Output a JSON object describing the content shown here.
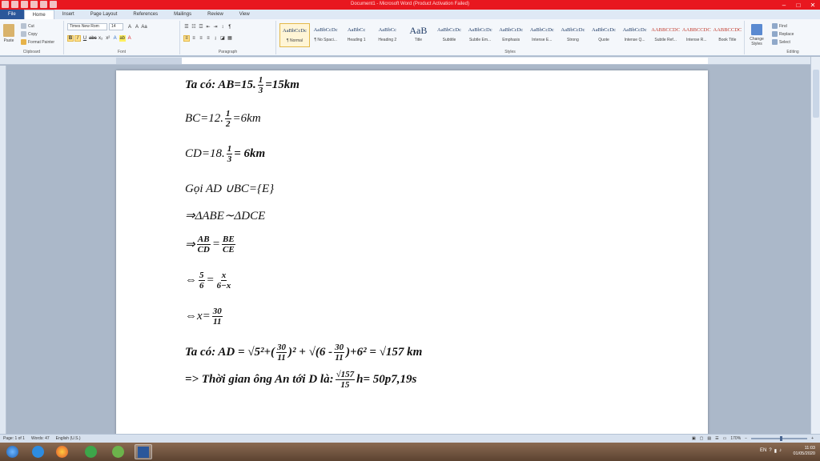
{
  "window": {
    "title": "Document1 - Microsoft Word (Product Activation Failed)",
    "minimize": "–",
    "maximize": "□",
    "close": "✕"
  },
  "tabs": [
    "File",
    "Home",
    "Insert",
    "Page Layout",
    "References",
    "Mailings",
    "Review",
    "View"
  ],
  "ribbon": {
    "clipboard": {
      "label": "Clipboard",
      "paste": "Paste",
      "cut": "Cut",
      "copy": "Copy",
      "format_painter": "Format Painter"
    },
    "font": {
      "label": "Font",
      "font_name": "Times New Rom",
      "font_size": "14",
      "grow": "A",
      "shrink": "A",
      "clear": "Aa",
      "bold": "B",
      "italic": "I",
      "underline": "U",
      "strike": "abc",
      "subscript": "x₂",
      "superscript": "x²",
      "text_effects": "A",
      "highlight": "ab",
      "font_color": "A"
    },
    "paragraph": {
      "label": "Paragraph"
    },
    "styles": {
      "label": "Styles",
      "items": [
        {
          "sample": "AaBbCcDc",
          "name": "¶ Normal"
        },
        {
          "sample": "AaBbCcDc",
          "name": "¶ No Spaci..."
        },
        {
          "sample": "AaBbCc",
          "name": "Heading 1"
        },
        {
          "sample": "AaBbCc",
          "name": "Heading 2"
        },
        {
          "sample": "AaB",
          "name": "Title"
        },
        {
          "sample": "AaBbCcDc",
          "name": "Subtitle"
        },
        {
          "sample": "AaBbCcDc",
          "name": "Subtle Em..."
        },
        {
          "sample": "AaBbCcDc",
          "name": "Emphasis"
        },
        {
          "sample": "AaBbCcDc",
          "name": "Intense E..."
        },
        {
          "sample": "AaBbCcDc",
          "name": "Strong"
        },
        {
          "sample": "AaBbCcDc",
          "name": "Quote"
        },
        {
          "sample": "AaBbCcDc",
          "name": "Intense Q..."
        },
        {
          "sample": "AABBCCDC",
          "name": "Subtle Ref..."
        },
        {
          "sample": "AABBCCDC",
          "name": "Intense R..."
        },
        {
          "sample": "AABBCCDC",
          "name": "Book Title"
        }
      ],
      "change_styles": "Change Styles"
    },
    "editing": {
      "label": "Editing",
      "find": "Find",
      "replace": "Replace",
      "select": "Select"
    }
  },
  "document": {
    "l1_prefix": "Ta có: AB=15.",
    "l1_num": "1",
    "l1_den": "3",
    "l1_suffix": "=15km",
    "l2_prefix": "BC=12.",
    "l2_num": "1",
    "l2_den": "2",
    "l2_suffix": "=6km",
    "l3_prefix": "CD=18.",
    "l3_num": "1",
    "l3_den": "3",
    "l3_suffix": "= 6km",
    "l4": "Gọi AD ∪BC={E}",
    "l5": "⇒ΔABE∼ΔDCE",
    "l6_prefix": "⇒",
    "l6_n1": "AB",
    "l6_d1": "CD",
    "l6_eq": "=",
    "l6_n2": "BE",
    "l6_d2": "CE",
    "l7_prefix": "⇔",
    "l7_n1": "5",
    "l7_d1": "6",
    "l7_eq": "=",
    "l7_n2": "x",
    "l7_d2": "6−x",
    "l8_prefix": "⇔x=",
    "l8_num": "30",
    "l8_den": "11",
    "l9_a": "Ta có: AD = √5²+(",
    "l9_n1": "30",
    "l9_d1": "11",
    "l9_b": ")² + √(6 -",
    "l9_n2": "30",
    "l9_d2": "11",
    "l9_c": ")+6² = √157 km",
    "l10_a": "=> Thời gian ông An tới D là:",
    "l10_num": "√157",
    "l10_den": "15",
    "l10_b": "h= 50p7,19s"
  },
  "status": {
    "page": "Page: 1 of 1",
    "words": "Words: 47",
    "language": "English (U.S.)",
    "zoom": "170%"
  },
  "taskbar": {
    "lang": "EN",
    "time": "11:03",
    "date": "01/05/2020"
  }
}
